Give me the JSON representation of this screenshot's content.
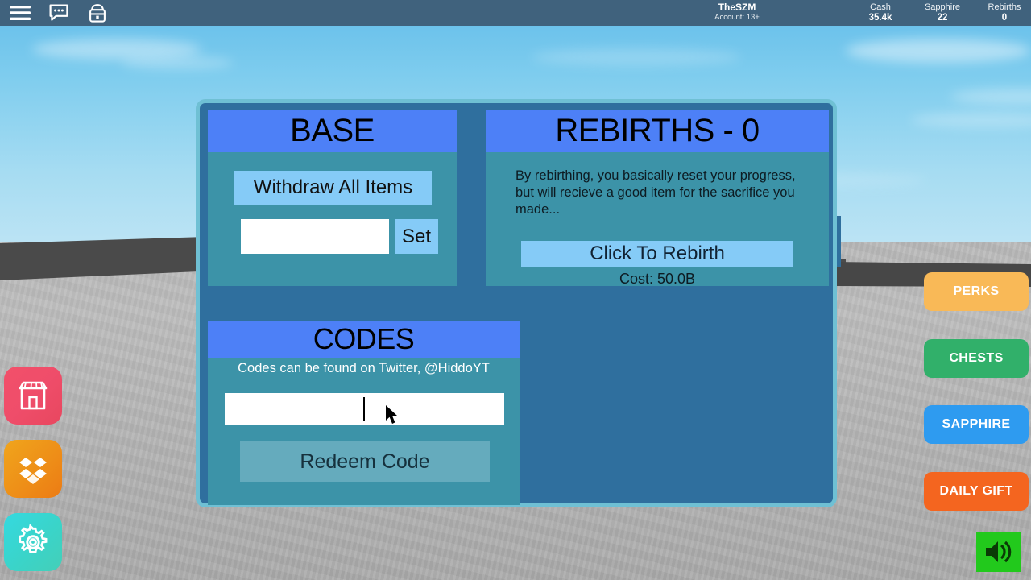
{
  "topbar": {
    "icons": [
      {
        "name": "menu-icon",
        "label": "Menu"
      },
      {
        "name": "chat-icon",
        "label": "Chat"
      },
      {
        "name": "backpack-icon",
        "label": "Backpack"
      }
    ],
    "user": {
      "name": "TheSZM",
      "account": "Account: 13+"
    },
    "stats": [
      {
        "label": "Cash",
        "value": "35.4k"
      },
      {
        "label": "Sapphire",
        "value": "22"
      },
      {
        "label": "Rebirths",
        "value": "0"
      }
    ]
  },
  "gui": {
    "base": {
      "title": "BASE",
      "withdraw_label": "Withdraw All Items",
      "amount_value": "",
      "amount_placeholder": "",
      "set_label": "Set"
    },
    "rebirth": {
      "title": "REBIRTHS - 0",
      "description": "By rebirthing, you basically reset your progress, but will recieve a good item for the sacrifice you made...",
      "button_label": "Click To Rebirth",
      "cost_label": "Cost: 50.0B"
    },
    "codes": {
      "title": "CODES",
      "subtitle": "Codes can be found on Twitter, @HiddoYT",
      "code_value": "",
      "code_placeholder": "",
      "redeem_label": "Redeem Code"
    }
  },
  "left_icons": [
    {
      "name": "shop-icon",
      "label": "Shop",
      "color": "#ef4d6a"
    },
    {
      "name": "inventory-icon",
      "label": "Inventory",
      "color": "#ee8f18"
    },
    {
      "name": "settings-icon",
      "label": "Settings",
      "color": "#3ad4c9"
    }
  ],
  "right_buttons": [
    {
      "name": "perks-button",
      "label": "PERKS",
      "color": "#f9b957"
    },
    {
      "name": "chests-button",
      "label": "CHESTS",
      "color": "#31b06a"
    },
    {
      "name": "sapphire-button",
      "label": "SAPPHIRE",
      "color": "#2e9bf0"
    },
    {
      "name": "daily-gift-button",
      "label": "DAILY GIFT",
      "color": "#f4651f"
    }
  ],
  "sound": {
    "name": "sound-icon",
    "label": "Sound",
    "color": "#22c91c"
  }
}
